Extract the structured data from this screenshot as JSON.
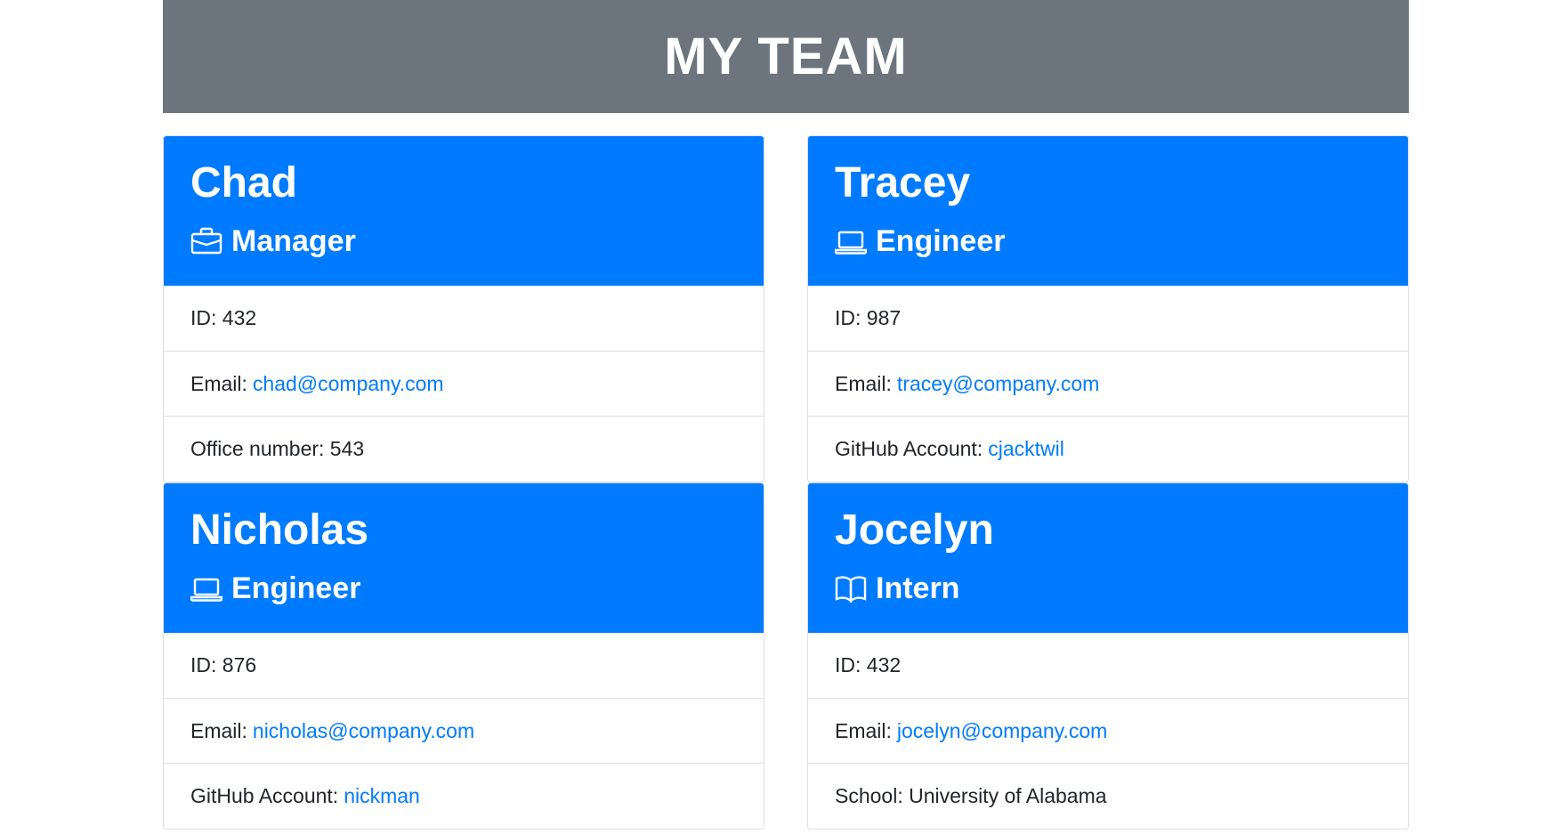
{
  "header": {
    "title": "MY TEAM"
  },
  "colors": {
    "header_bg": "#6c757d",
    "card_header_bg": "#007bff",
    "link": "#007bff"
  },
  "cards": [
    {
      "name": "Chad",
      "role": "Manager",
      "role_icon": "briefcase-icon",
      "id_label": "ID: 432",
      "email_label": "Email:",
      "email": "chad@company.com",
      "extra_label": "Office number: 543",
      "extra_link": ""
    },
    {
      "name": "Tracey",
      "role": "Engineer",
      "role_icon": "laptop-icon",
      "id_label": "ID: 987",
      "email_label": "Email:",
      "email": "tracey@company.com",
      "extra_label": "GitHub Account:",
      "extra_link": "cjacktwil"
    },
    {
      "name": "Nicholas",
      "role": "Engineer",
      "role_icon": "laptop-icon",
      "id_label": "ID: 876",
      "email_label": "Email:",
      "email": "nicholas@company.com",
      "extra_label": "GitHub Account:",
      "extra_link": "nickman"
    },
    {
      "name": "Jocelyn",
      "role": "Intern",
      "role_icon": "book-icon",
      "id_label": "ID: 432",
      "email_label": "Email:",
      "email": "jocelyn@company.com",
      "extra_label": "School: University of Alabama",
      "extra_link": ""
    }
  ]
}
